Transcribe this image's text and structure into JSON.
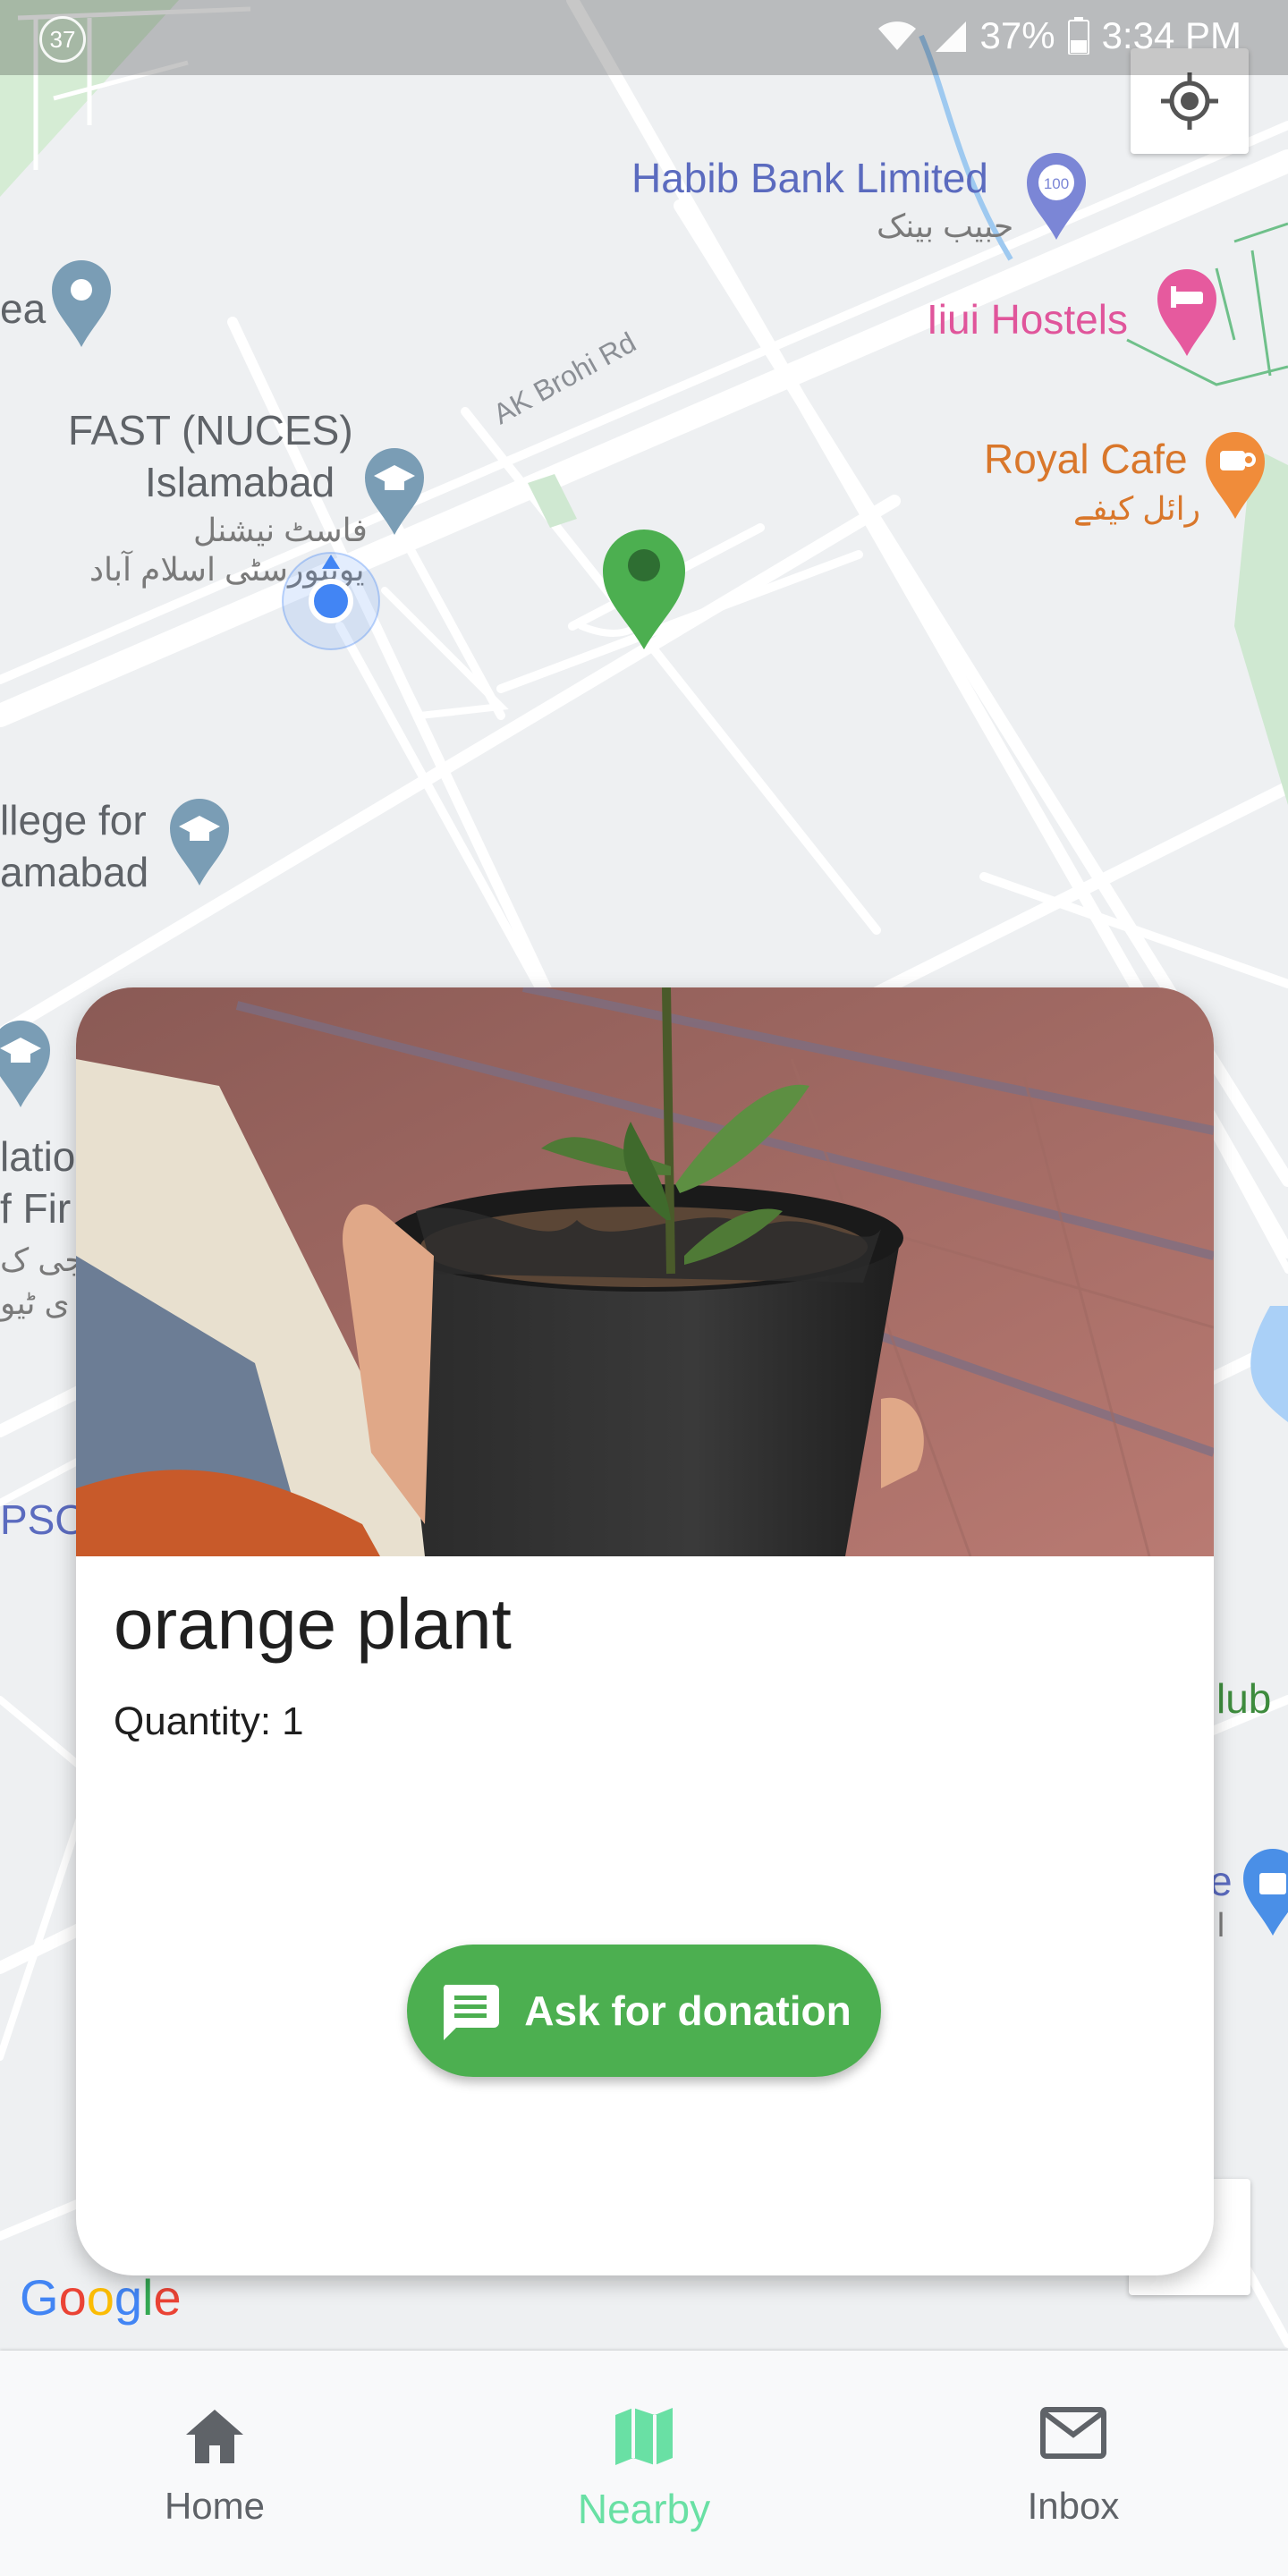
{
  "status_bar": {
    "notification_badge": "37",
    "battery": "37%",
    "time": "3:34 PM",
    "icons": [
      "wifi-icon",
      "signal-icon",
      "battery-icon"
    ]
  },
  "map": {
    "labels": {
      "habib_bank": "Habib Bank Limited",
      "habib_bank_ur": "حبیب بینک",
      "habib_badge": "100",
      "hostels": "Iiui Hostels",
      "royal_cafe": "Royal Cafe",
      "royal_cafe_ur": "رائل کیفے",
      "road": "AK Brohi Rd",
      "fast_line1": "FAST (NUCES)",
      "fast_line2": "Islamabad",
      "fast_ur1": "فاسٹ نیشنل",
      "fast_ur2": "یونیورسٹی اسلام آباد",
      "ea": "ea",
      "college_line1": "llege for",
      "college_line2": "amabad",
      "lati_1": "latio",
      "lati_2": "f Fir",
      "lati_3": "وجی ک",
      "lati_4": "ی ٹیو",
      "pso": "PSO",
      "club": "lub",
      "shop_e": "e",
      "shop_ur": "ا"
    },
    "google": [
      "G",
      "o",
      "o",
      "g",
      "l",
      "e"
    ],
    "google_colors": [
      "#4285F4",
      "#EA4335",
      "#FBBC05",
      "#4285F4",
      "#34A853",
      "#EA4335"
    ]
  },
  "card": {
    "title": "orange plant",
    "quantity_label": "Quantity:",
    "quantity_value": "1",
    "button_label": "Ask for donation"
  },
  "bottom_nav": {
    "items": [
      {
        "label": "Home",
        "icon": "home-icon",
        "active": false
      },
      {
        "label": "Nearby",
        "icon": "map-icon",
        "active": true
      },
      {
        "label": "Inbox",
        "icon": "mail-icon",
        "active": false
      }
    ]
  },
  "colors": {
    "accent_green": "#4caf50",
    "nearby_active": "#69e0a4",
    "my_location": "#4285F4"
  }
}
